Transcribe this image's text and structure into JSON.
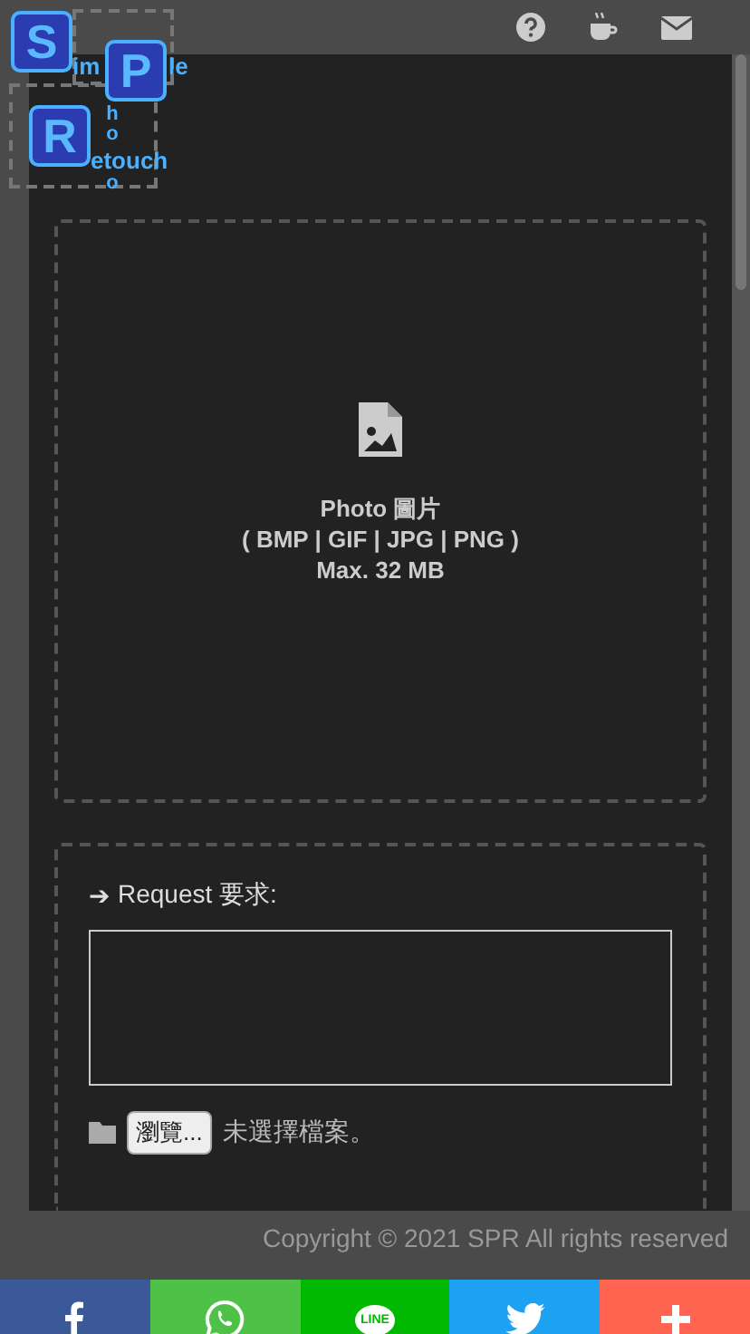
{
  "logo": {
    "letters": [
      "S",
      "P",
      "R"
    ],
    "im": "im",
    "le": "le",
    "hoto_top": "ho",
    "hoto_bottom": "o",
    "etouch": "etouch"
  },
  "upload": {
    "title": "Photo 圖片",
    "formats": "( BMP | GIF | JPG | PNG )",
    "max": "Max. 32 MB"
  },
  "request": {
    "arrow": "➔",
    "label": "Request 要求:",
    "browse_button": "瀏覽...",
    "file_status": "未選擇檔案。"
  },
  "footer": {
    "copyright": "Copyright © 2021 SPR All rights reserved"
  },
  "share": [
    {
      "kind": "facebook",
      "color": "#3b5998"
    },
    {
      "kind": "whatsapp",
      "color": "#4dc247"
    },
    {
      "kind": "line",
      "color": "#00b900",
      "label": "LINE"
    },
    {
      "kind": "twitter",
      "color": "#1da1f2"
    },
    {
      "kind": "more",
      "color": "#ff6550"
    }
  ]
}
